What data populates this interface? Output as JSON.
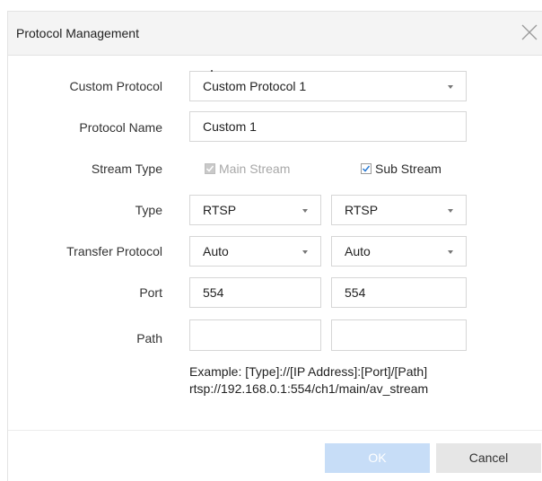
{
  "dialog": {
    "title": "Protocol Management",
    "close_icon": "close-icon"
  },
  "form": {
    "custom_protocol": {
      "label": "Custom Protocol",
      "value": "Custom Protocol 1"
    },
    "protocol_name": {
      "label": "Protocol Name",
      "value": "Custom 1"
    },
    "stream_type": {
      "label": "Stream Type",
      "main": {
        "label": "Main Stream",
        "checked": true,
        "disabled": true
      },
      "sub": {
        "label": "Sub Stream",
        "checked": true,
        "disabled": false
      }
    },
    "type": {
      "label": "Type",
      "main_value": "RTSP",
      "sub_value": "RTSP"
    },
    "transfer_protocol": {
      "label": "Transfer Protocol",
      "main_value": "Auto",
      "sub_value": "Auto"
    },
    "port": {
      "label": "Port",
      "main_value": "554",
      "sub_value": "554"
    },
    "path": {
      "label": "Path",
      "main_value": "",
      "sub_value": ""
    },
    "example": {
      "line1": "Example: [Type]://[IP Address]:[Port]/[Path]",
      "line2": "rtsp://192.168.0.1:554/ch1/main/av_stream"
    }
  },
  "buttons": {
    "ok": "OK",
    "cancel": "Cancel"
  },
  "colors": {
    "ok_bg": "#c7ddf7",
    "cancel_bg": "#e6e6e6",
    "header_bg": "#f4f4f4"
  }
}
